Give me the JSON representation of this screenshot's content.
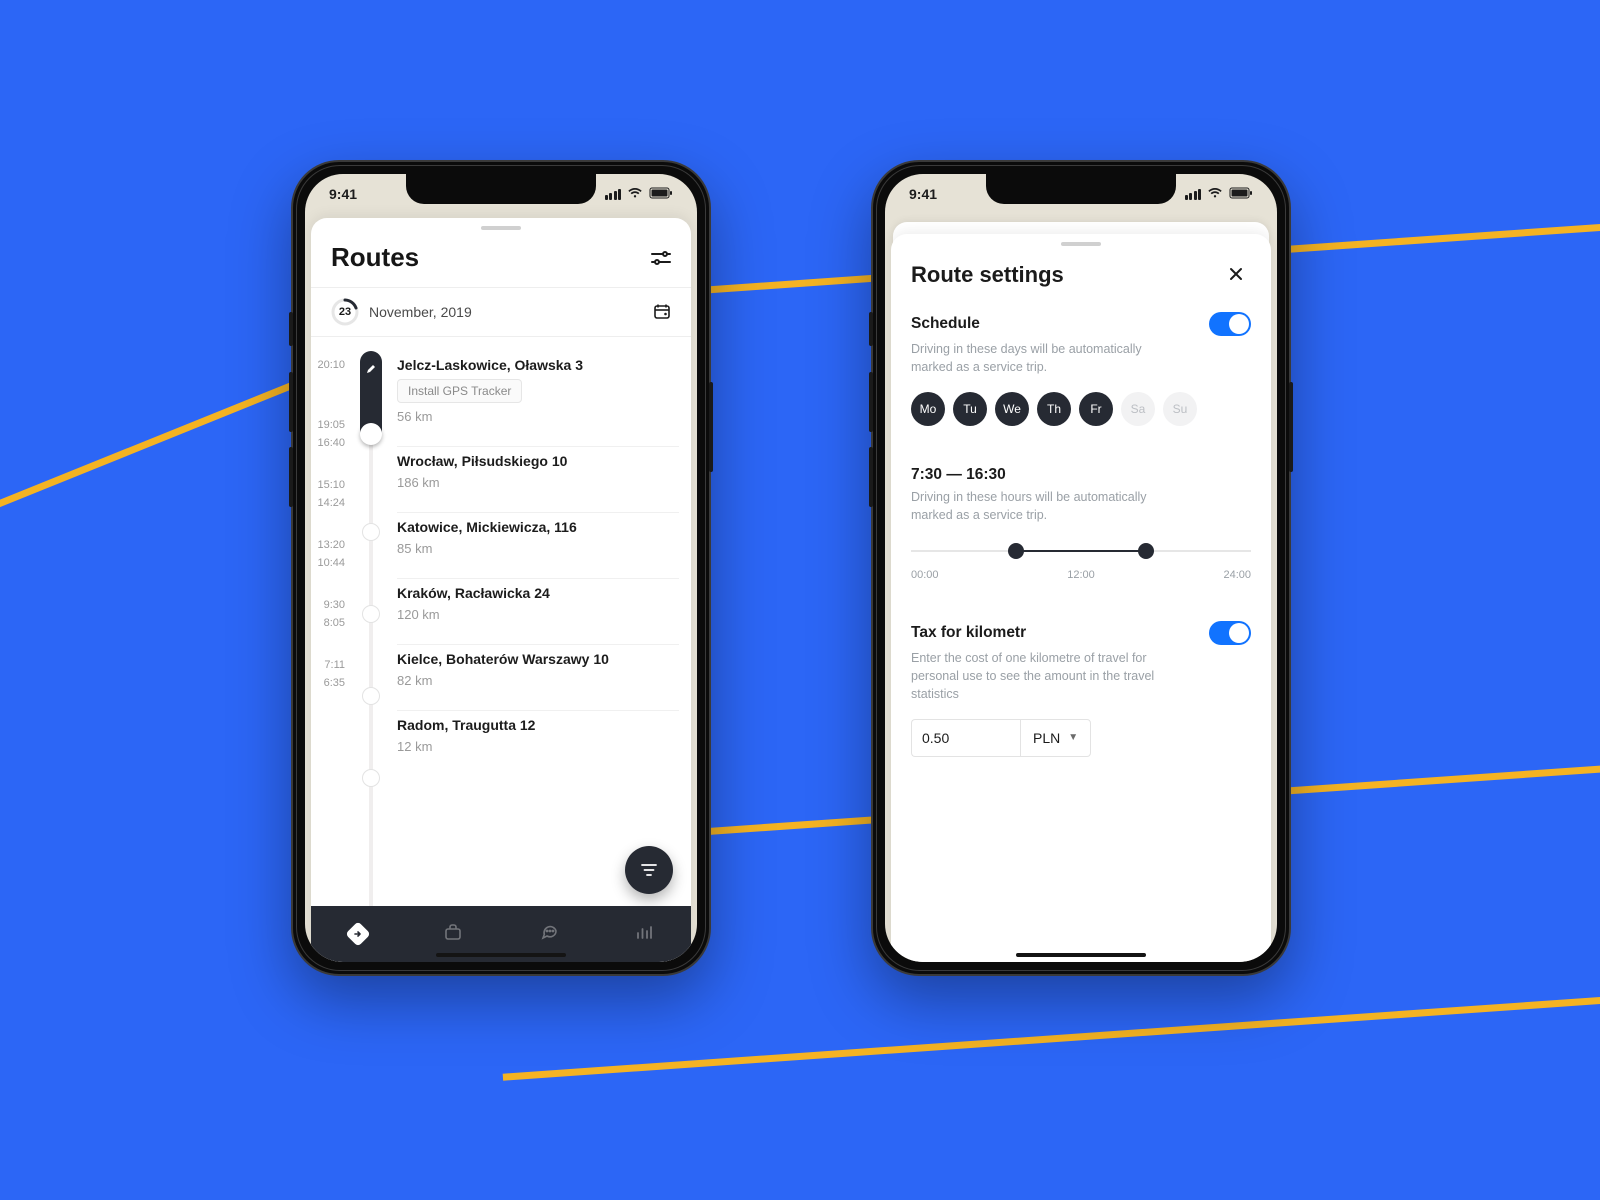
{
  "status": {
    "time": "9:41"
  },
  "routes": {
    "title": "Routes",
    "dateDay": "23",
    "dateLabel": "November, 2019",
    "times": [
      [
        "20:10",
        ""
      ],
      [
        "19:05",
        "16:40"
      ],
      [
        "15:10",
        "14:24"
      ],
      [
        "13:20",
        "10:44"
      ],
      [
        "9:30",
        "8:05"
      ],
      [
        "7:11",
        "6:35"
      ]
    ],
    "items": [
      {
        "name": "Jelcz-Laskowice, Oławska 3",
        "tag": "Install GPS Tracker",
        "km": "56 km"
      },
      {
        "name": "Wrocław, Piłsudskiego 10",
        "km": "186 km"
      },
      {
        "name": "Katowice, Mickiewicza, 116",
        "km": "85 km"
      },
      {
        "name": "Kraków, Racławicka 24",
        "km": "120 km"
      },
      {
        "name": "Kielce, Bohaterów Warszawy 10",
        "km": "82 km"
      },
      {
        "name": "Radom, Traugutta 12",
        "km": "12 km"
      }
    ]
  },
  "settings": {
    "title": "Route settings",
    "schedule": {
      "title": "Schedule",
      "sub": "Driving in these days will be automatically marked as a service trip.",
      "days": [
        {
          "label": "Mo",
          "on": true
        },
        {
          "label": "Tu",
          "on": true
        },
        {
          "label": "We",
          "on": true
        },
        {
          "label": "Th",
          "on": true
        },
        {
          "label": "Fr",
          "on": true
        },
        {
          "label": "Sa",
          "on": false
        },
        {
          "label": "Su",
          "on": false
        }
      ]
    },
    "hours": {
      "range": "7:30 — 16:30",
      "sub": "Driving in these hours will be automatically marked as a service trip.",
      "ticks": {
        "start": "00:00",
        "mid": "12:00",
        "end": "24:00"
      },
      "startPct": 31,
      "endPct": 69
    },
    "tax": {
      "title": "Tax for kilometr",
      "sub": "Enter the cost of one kilometre of travel for personal use to see the amount in the travel statistics",
      "value": "0.50",
      "currency": "PLN"
    }
  }
}
